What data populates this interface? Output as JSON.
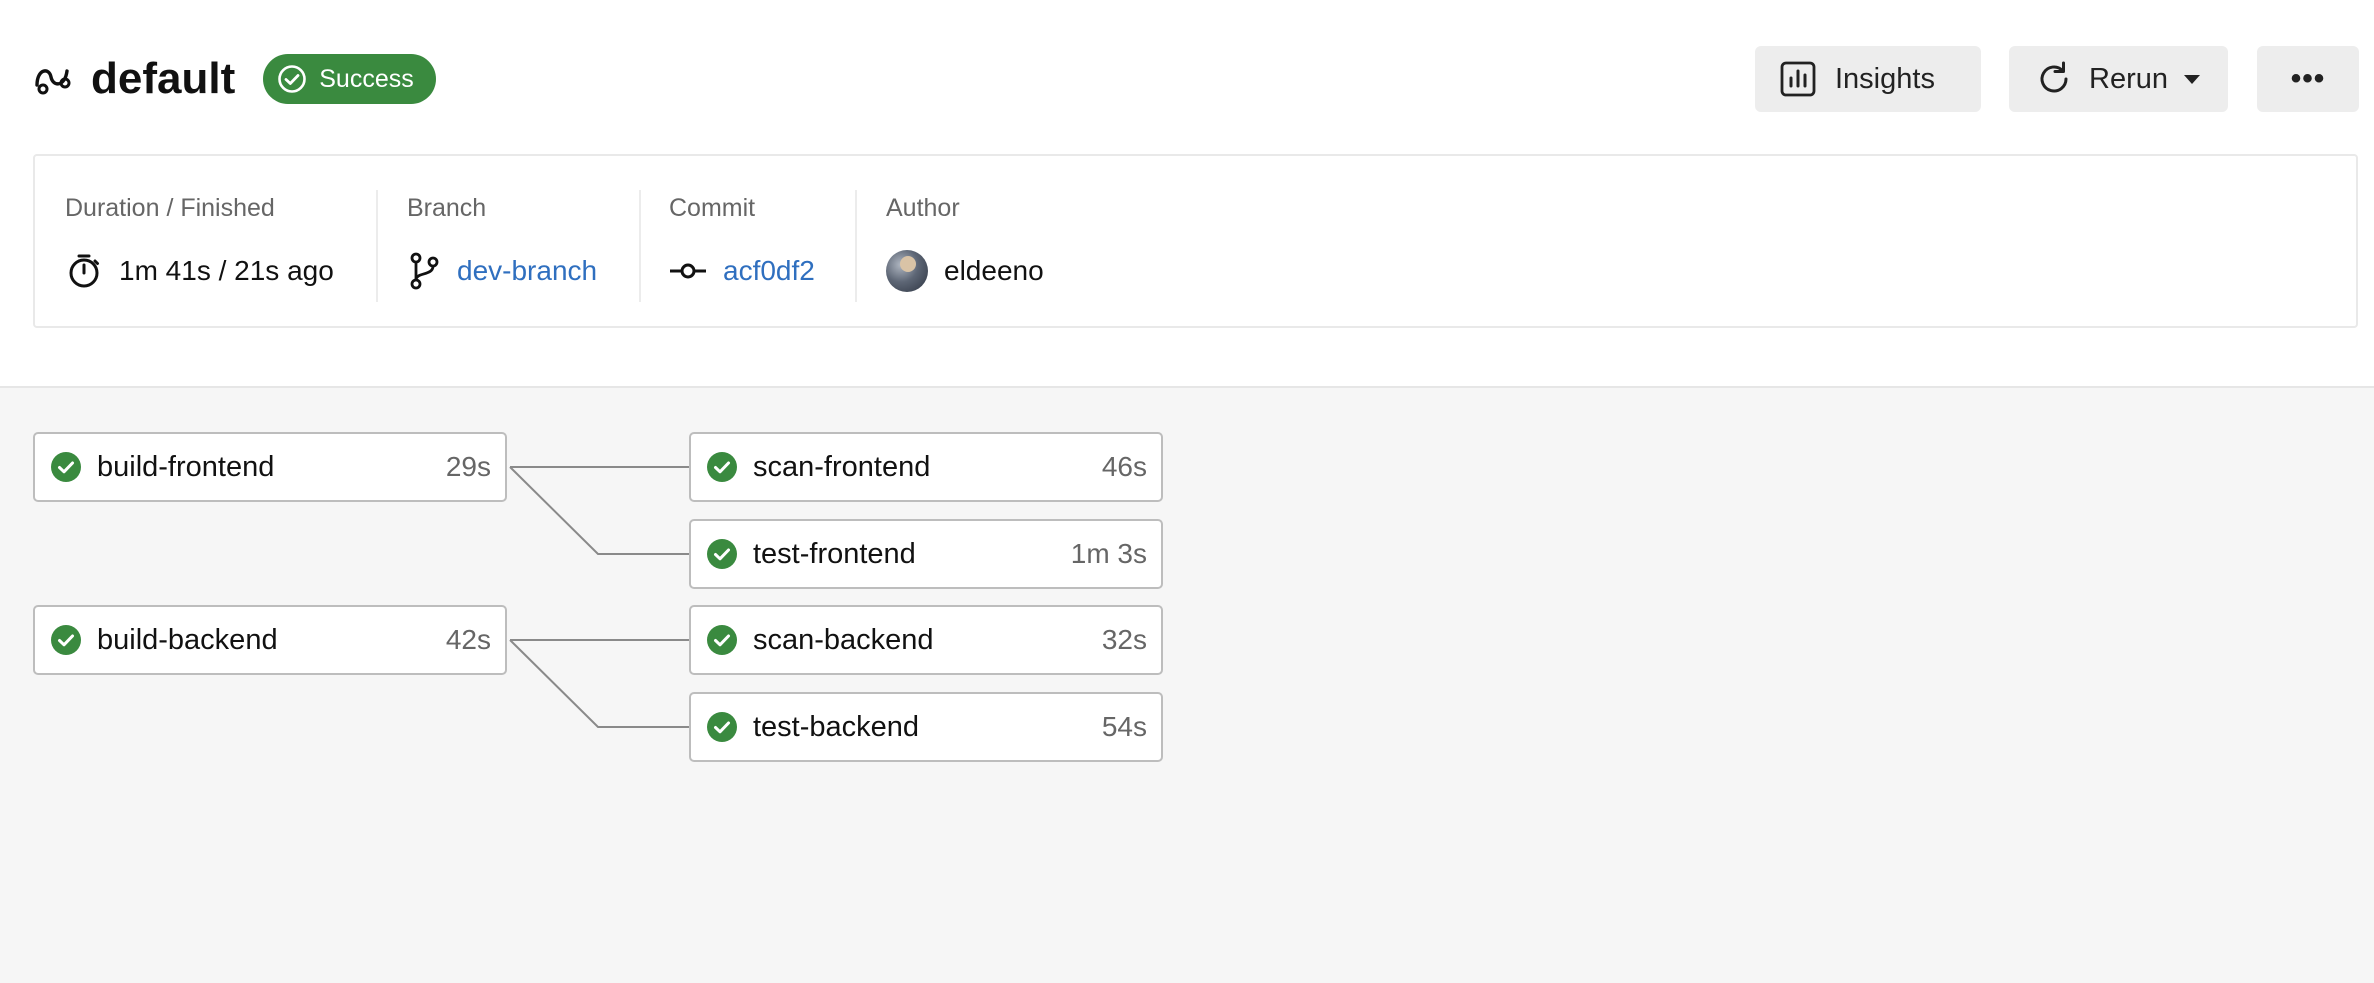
{
  "header": {
    "title": "default",
    "status": "Success",
    "buttons": {
      "insights": "Insights",
      "rerun": "Rerun",
      "more": "•••"
    }
  },
  "info": {
    "duration_label": "Duration / Finished",
    "duration_value": "1m 41s / 21s ago",
    "branch_label": "Branch",
    "branch_value": "dev-branch",
    "commit_label": "Commit",
    "commit_value": "acf0df2",
    "author_label": "Author",
    "author_value": "eldeeno"
  },
  "jobs": [
    {
      "name": "build-frontend",
      "duration": "29s",
      "status": "success"
    },
    {
      "name": "scan-frontend",
      "duration": "46s",
      "status": "success"
    },
    {
      "name": "test-frontend",
      "duration": "1m 3s",
      "status": "success"
    },
    {
      "name": "build-backend",
      "duration": "42s",
      "status": "success"
    },
    {
      "name": "scan-backend",
      "duration": "32s",
      "status": "success"
    },
    {
      "name": "test-backend",
      "duration": "54s",
      "status": "success"
    }
  ],
  "colors": {
    "success": "#3a8a3f",
    "link": "#2f6fbf",
    "edge": "#8a8a8a"
  },
  "icons": {
    "workflow": "workflow-icon",
    "success": "check-circle-icon",
    "insights": "bar-chart-icon",
    "rerun": "refresh-icon",
    "more": "ellipsis-icon",
    "duration": "stopwatch-icon",
    "branch": "git-branch-icon",
    "commit": "git-commit-icon",
    "author": "avatar"
  }
}
